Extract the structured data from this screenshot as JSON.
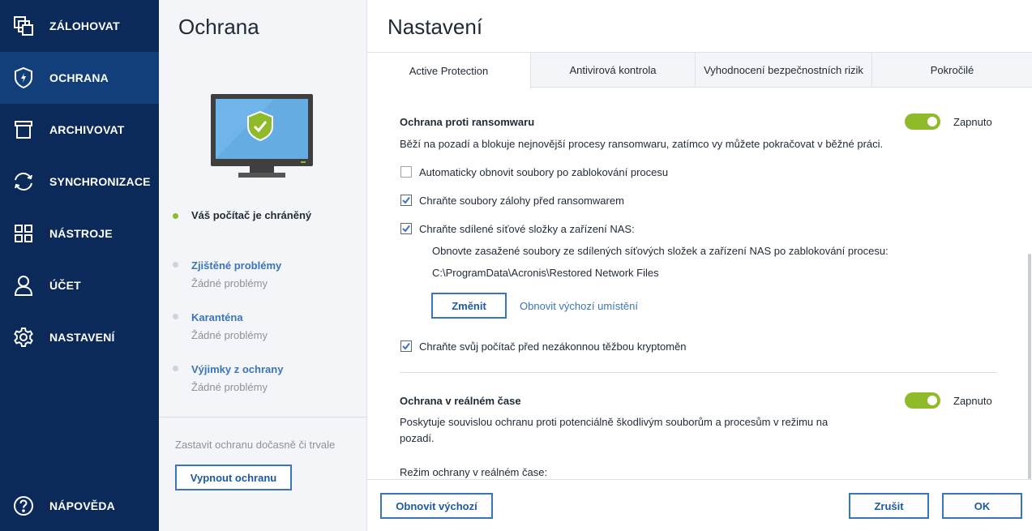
{
  "sidebar": {
    "items": [
      {
        "label": "ZÁLOHOVAT",
        "icon": "backup-icon"
      },
      {
        "label": "OCHRANA",
        "icon": "shield-icon",
        "active": true
      },
      {
        "label": "ARCHIVOVAT",
        "icon": "archive-icon"
      },
      {
        "label": "SYNCHRONIZACE",
        "icon": "sync-icon"
      },
      {
        "label": "NÁSTROJE",
        "icon": "tools-grid-icon"
      },
      {
        "label": "ÚČET",
        "icon": "account-icon"
      },
      {
        "label": "NASTAVENÍ",
        "icon": "gear-icon"
      }
    ],
    "help": {
      "label": "NÁPOVĚDA",
      "icon": "help-icon"
    }
  },
  "middle": {
    "title": "Ochrana",
    "status_main": "Váš počítač je chráněný",
    "status_items": [
      {
        "title": "Zjištěné problémy",
        "sub": "Žádné problémy"
      },
      {
        "title": "Karanténa",
        "sub": "Žádné problémy"
      },
      {
        "title": "Výjimky z ochrany",
        "sub": "Žádné problémy"
      }
    ],
    "pause_text": "Zastavit ochranu dočasně či trvale",
    "disable_button": "Vypnout ochranu"
  },
  "settings": {
    "title": "Nastavení",
    "tabs": [
      "Active Protection",
      "Antivirová kontrola",
      "Vyhodnocení bezpečnostních rizik",
      "Pokročilé"
    ],
    "active_tab": 0,
    "ransomware": {
      "title": "Ochrana proti ransomwaru",
      "toggle_label": "Zapnuto",
      "description": "Běží na pozadí a blokuje nejnovější procesy ransomwaru, zatímco vy můžete pokračovat v běžné práci.",
      "options": [
        {
          "label": "Automaticky obnovit soubory po zablokování procesu",
          "checked": false
        },
        {
          "label": "Chraňte soubory zálohy před ransomwarem",
          "checked": true
        },
        {
          "label": "Chraňte sdílené síťové složky a zařízení NAS:",
          "checked": true
        }
      ],
      "nas_note": "Obnovte zasažené soubory ze sdílených síťových složek a zařízení NAS po zablokování procesu:",
      "nas_path": "C:\\ProgramData\\Acronis\\Restored Network Files",
      "change_button": "Změnit",
      "reset_location_link": "Obnovit výchozí umístění",
      "crypto_option": {
        "label": "Chraňte svůj počítač před nezákonnou těžbou kryptoměn",
        "checked": true
      }
    },
    "realtime": {
      "title": "Ochrana v reálném čase",
      "toggle_label": "Zapnuto",
      "description_line1": "Poskytuje souvislou ochranu proti potenciálně škodlivým souborům a procesům v režimu na",
      "description_line2": "pozadí.",
      "mode_label": "Režim ochrany v reálném čase:"
    },
    "footer": {
      "reset_button": "Obnovit výchozí",
      "cancel_button": "Zrušit",
      "ok_button": "OK"
    }
  },
  "colors": {
    "sidebar_bg": "#0b2a5a",
    "sidebar_active": "#123f7a",
    "accent": "#3a74b9",
    "toggle_on": "#8fbb2a",
    "status_ok": "#8fbb2a"
  }
}
